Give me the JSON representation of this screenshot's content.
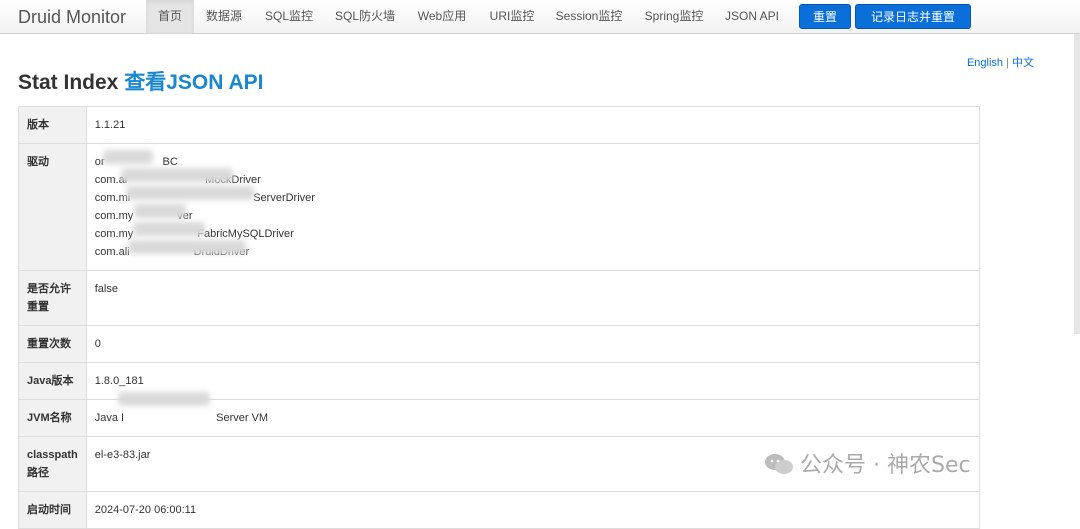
{
  "nav": {
    "brand": "Druid Monitor",
    "items": [
      {
        "label": "首页"
      },
      {
        "label": "数据源"
      },
      {
        "label": "SQL监控"
      },
      {
        "label": "SQL防火墙"
      },
      {
        "label": "Web应用"
      },
      {
        "label": "URI监控"
      },
      {
        "label": "Session监控"
      },
      {
        "label": "Spring监控"
      },
      {
        "label": "JSON API"
      }
    ],
    "reset_label": "重置",
    "log_reset_label": "记录日志并重置"
  },
  "lang": {
    "english": "English",
    "separator": "|",
    "chinese": "中文"
  },
  "page": {
    "title": "Stat Index",
    "json_link": "查看JSON API"
  },
  "rows": [
    {
      "key": "版本",
      "values": [
        "1.1.21"
      ]
    },
    {
      "key": "驱动",
      "values": [
        "or",
        "BC",
        "com.al",
        "MockDriver",
        "com.mi",
        "ServerDriver",
        "com.my",
        "ver",
        "com.my",
        "FabricMySQLDriver",
        "com.ali",
        "DruidDriver"
      ]
    },
    {
      "key": "是否允许重置",
      "values": [
        "false"
      ]
    },
    {
      "key": "重置次数",
      "values": [
        "0"
      ]
    },
    {
      "key": "Java版本",
      "values": [
        "1.8.0_181"
      ]
    },
    {
      "key": "JVM名称",
      "values": [
        "Java I",
        "Server VM"
      ]
    },
    {
      "key": "classpath路径",
      "values": [
        "el-e3-83.jar"
      ]
    },
    {
      "key": "启动时间",
      "values": [
        "2024-07-20 06:00:11"
      ]
    }
  ],
  "watermark": {
    "text": "公众号 · 神农Sec"
  }
}
